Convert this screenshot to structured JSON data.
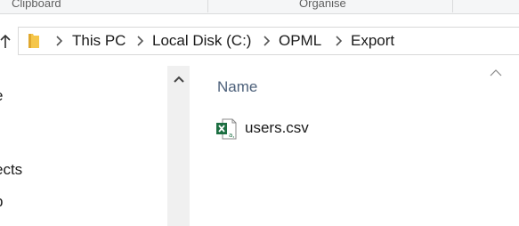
{
  "ribbon": {
    "groups": [
      "Clipboard",
      "Organise"
    ]
  },
  "address_bar": {
    "breadcrumbs": [
      "This PC",
      "Local Disk (C:)",
      "OPML",
      "Export"
    ]
  },
  "nav_pane": {
    "items": [
      "e",
      "ects",
      "p"
    ]
  },
  "content": {
    "column_header": "Name",
    "files": [
      {
        "name": "users.csv",
        "icon": "excel-csv-icon"
      }
    ]
  },
  "colors": {
    "accent_header_text": "#4c607a",
    "folder_yellow": "#f5c64a",
    "excel_green": "#1d6f42"
  }
}
